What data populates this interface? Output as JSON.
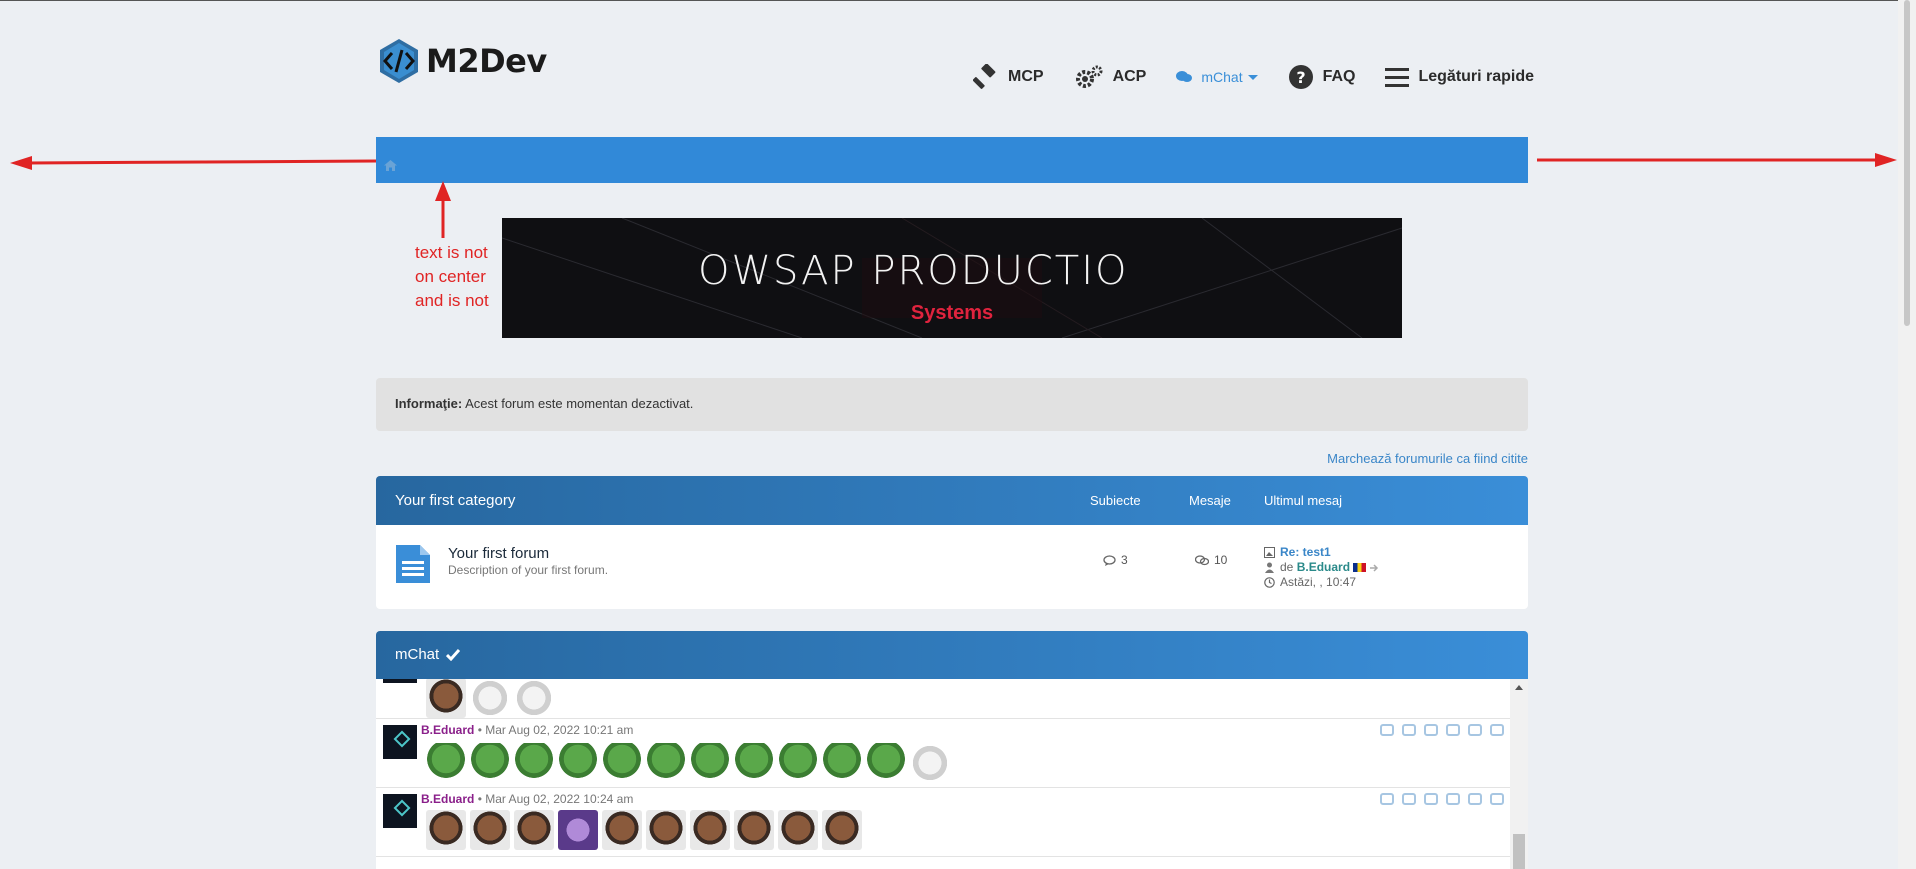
{
  "header": {
    "logo_text": "M2Dev",
    "nav": [
      {
        "label": "MCP",
        "icon": "gavel-icon"
      },
      {
        "label": "ACP",
        "icon": "gears-icon"
      },
      {
        "label": "mChat",
        "icon": "chat-icon"
      },
      {
        "label": "FAQ",
        "icon": "question-circle-icon"
      },
      {
        "label": "Legături rapide",
        "icon": "hamburger-icon"
      }
    ]
  },
  "annotation": {
    "text": "text is not\non center\nand is not",
    "color": "#e02424"
  },
  "banner": {
    "title": "OWSAP PRODUCTIO",
    "subtitle": "Systems"
  },
  "info": {
    "label": "Informaţie:",
    "message": "Acest forum este momentan dezactivat."
  },
  "mark_read_link": "Marchează forumurile ca fiind citite",
  "category": {
    "title": "Your first category",
    "columns": {
      "topics": "Subiecte",
      "posts": "Mesaje",
      "last": "Ultimul mesaj"
    },
    "forum": {
      "title": "Your first forum",
      "description": "Description of your first forum.",
      "topics": "3",
      "posts": "10",
      "last_post_title": "Re: test1",
      "last_post_by_prefix": "de",
      "last_post_user": "B.Eduard",
      "last_post_time": "Astăzi, , 10:47"
    }
  },
  "mchat": {
    "title": "mChat",
    "messages": [
      {
        "user": "B.Eduard",
        "time": "• Mar Aug 02, 2022 10:21 am"
      },
      {
        "user": "B.Eduard",
        "time": "• Mar Aug 02, 2022 10:24 am"
      }
    ]
  },
  "colors": {
    "accent": "#3189d8",
    "background": "#eceff3",
    "annotation_red": "#e02424",
    "username_purple": "#8a1f8a"
  }
}
